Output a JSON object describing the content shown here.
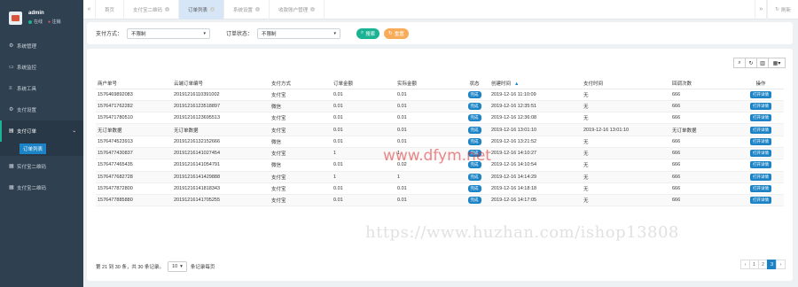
{
  "sidebar": {
    "user": {
      "name": "admin",
      "status_online": "在线",
      "status_logout": "注销"
    },
    "menu": [
      {
        "label": "系统管理",
        "icon": "gear-icon"
      },
      {
        "label": "系统监控",
        "icon": "monitor-icon"
      },
      {
        "label": "系统工具",
        "icon": "bars-icon"
      },
      {
        "label": "支付设置",
        "icon": "gear-icon"
      },
      {
        "label": "支付订单",
        "icon": "book-icon",
        "active": true
      },
      {
        "label": "实付宝二维码",
        "icon": "grid-icon"
      },
      {
        "label": "支付宝二维码",
        "icon": "grid-icon"
      }
    ],
    "submenu_active": "订单列表"
  },
  "tabbar": {
    "prev_icon": "«",
    "tabs": [
      {
        "label": "首页"
      },
      {
        "label": "支付宝二维码"
      },
      {
        "label": "订单列表",
        "active": true
      },
      {
        "label": "系统设置"
      },
      {
        "label": "收款账户管理"
      }
    ],
    "next_icon": "»",
    "refresh_label": "刷新"
  },
  "search": {
    "pay_method_label": "支付方式：",
    "pay_method_value": "不限制",
    "order_status_label": "订单状态：",
    "order_status_value": "不限制",
    "search_btn": "搜索",
    "reset_btn": "重置"
  },
  "table": {
    "columns": [
      "商户单号",
      "云端订单编号",
      "支付方式",
      "订单金额",
      "实际金额",
      "状态",
      "创建时间",
      "支付时间",
      "回调次数",
      "操作"
    ],
    "rows": [
      [
        "1576469892083",
        "20191216110391002",
        "支付宝",
        "0.01",
        "0.01",
        "完成",
        "2019-12-16 11:10:09",
        "无",
        "666",
        "打开详情"
      ],
      [
        "1576471762282",
        "20191216123518897",
        "微信",
        "0.01",
        "0.01",
        "完成",
        "2019-12-16 12:35:51",
        "无",
        "666",
        "打开详情"
      ],
      [
        "1576471780510",
        "20191216123695513",
        "支付宝",
        "0.01",
        "0.01",
        "完成",
        "2019-12-16 12:36:08",
        "无",
        "666",
        "打开详情"
      ],
      [
        "无订单数据",
        "无订单数据",
        "支付宝",
        "0.01",
        "0.01",
        "完成",
        "2019-12-16 13:01:10",
        "2019-12-16 13:01:10",
        "无订单数据",
        "打开详情"
      ],
      [
        "1576474523913",
        "20191216132152666",
        "微信",
        "0.01",
        "0.01",
        "完成",
        "2019-12-16 13:21:52",
        "无",
        "666",
        "打开详情"
      ],
      [
        "1576477430837",
        "20191216141027454",
        "支付宝",
        "1",
        "1",
        "完成",
        "2019-12-16 14:10:27",
        "无",
        "666",
        "打开详情"
      ],
      [
        "1576477465435",
        "20191216141054791",
        "微信",
        "0.01",
        "0.02",
        "完成",
        "2019-12-16 14:10:54",
        "无",
        "666",
        "打开详情"
      ],
      [
        "1576477682728",
        "20191216141429888",
        "支付宝",
        "1",
        "1",
        "完成",
        "2019-12-16 14:14:29",
        "无",
        "666",
        "打开详情"
      ],
      [
        "1576477872800",
        "20191216141818343",
        "支付宝",
        "0.01",
        "0.01",
        "完成",
        "2019-12-16 14:18:18",
        "无",
        "666",
        "打开详情"
      ],
      [
        "1576477885880",
        "20191216141705255",
        "支付宝",
        "0.01",
        "0.01",
        "完成",
        "2019-12-16 14:17:05",
        "无",
        "666",
        "打开详情"
      ]
    ]
  },
  "footer": {
    "range_text": "第 21 到 30 条，共 30 条记录。",
    "page_size": "10",
    "per_page_text": "条记录每页"
  },
  "pagination": {
    "prev": "‹",
    "pages": [
      "1",
      "2",
      "3"
    ],
    "active_page": "3",
    "next": "›"
  },
  "watermarks": {
    "primary": "www.dfym.net",
    "secondary": "https://www.huzhan.com/ishop13808"
  },
  "colors": {
    "sidebar": "#2f4050",
    "accent": "#1c84c6",
    "green": "#1ab394",
    "orange": "#f8ac59"
  }
}
